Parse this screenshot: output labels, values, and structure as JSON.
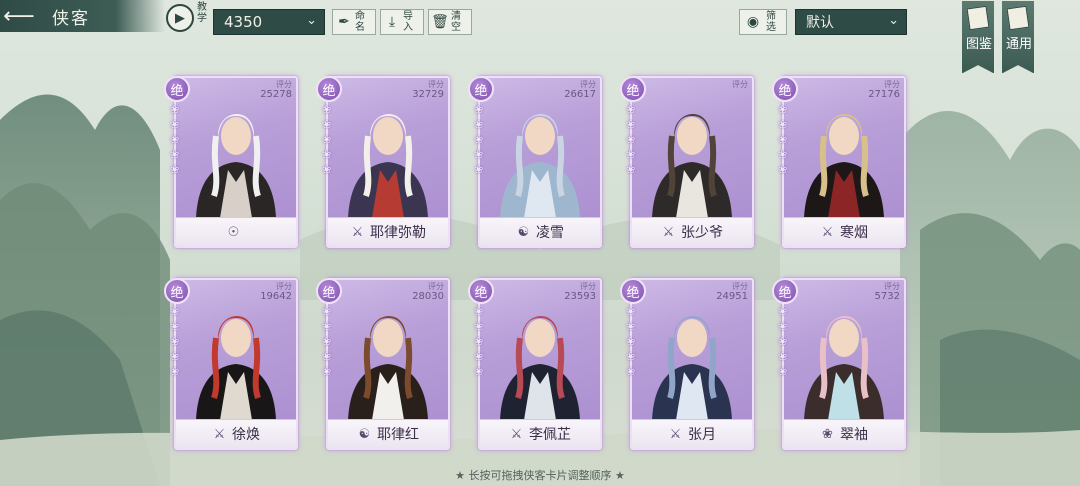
{
  "header": {
    "back_title": "侠客",
    "tutorial_label": "教学",
    "score_value": "4350",
    "rename_label": "命名",
    "import_label": "导入",
    "clear_label": "清空",
    "filter_label": "筛选",
    "sort_value": "默认",
    "atlas_label": "图鉴",
    "general_label": "通用"
  },
  "score_label": "评分",
  "rank_label": "绝",
  "cards": [
    {
      "name": "",
      "score": "25278",
      "faction": "sun"
    },
    {
      "name": "耶律弥勒",
      "score": "32729",
      "faction": "sword"
    },
    {
      "name": "凌雪",
      "score": "26617",
      "faction": "yinyang"
    },
    {
      "name": "张少爷",
      "score": "",
      "faction": "sword"
    },
    {
      "name": "寒烟",
      "score": "27176",
      "faction": "sword"
    },
    {
      "name": "徐焕",
      "score": "19642",
      "faction": "sword"
    },
    {
      "name": "耶律红",
      "score": "28030",
      "faction": "yinyang"
    },
    {
      "name": "李佩芷",
      "score": "23593",
      "faction": "sword"
    },
    {
      "name": "张月",
      "score": "24951",
      "faction": "sword"
    },
    {
      "name": "翠袖",
      "score": "5732",
      "faction": "lotus"
    }
  ],
  "footer_hint": "★ 长按可拖拽侠客卡片调整顺序 ★",
  "colors": {
    "card_purple": "#b89fd8",
    "header_green": "#2f4b45"
  }
}
